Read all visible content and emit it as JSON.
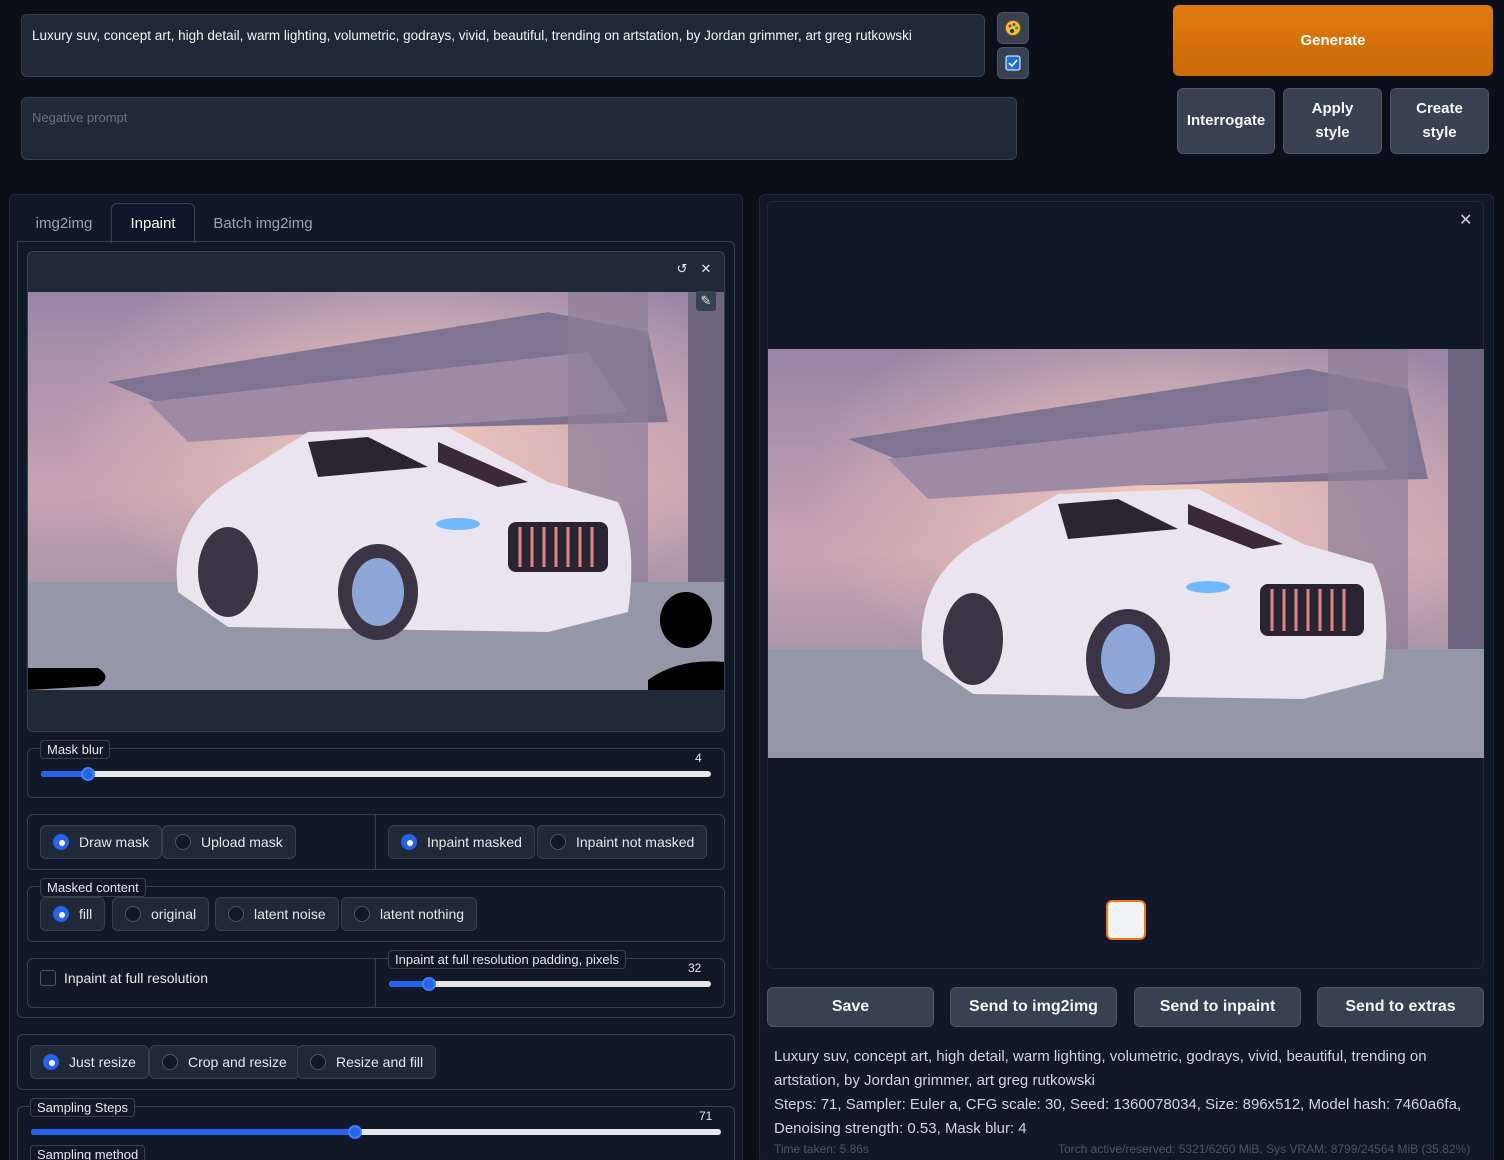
{
  "prompt": {
    "text": "Luxury suv, concept art, high detail, warm lighting, volumetric, godrays, vivid, beautiful, trending on artstation, by Jordan grimmer, art greg rutkowski",
    "negative_placeholder": "Negative prompt"
  },
  "actions": {
    "generate": "Generate",
    "interrogate": "Interrogate",
    "apply_style": "Apply style",
    "create_style": "Create style"
  },
  "tabs": [
    "img2img",
    "Inpaint",
    "Batch img2img"
  ],
  "mask_blur": {
    "label": "Mask blur",
    "value": "4",
    "fraction": 0.07
  },
  "mask_mode": {
    "draw": "Draw mask",
    "upload": "Upload mask",
    "selected": "Draw mask"
  },
  "inpaint_mode": {
    "masked": "Inpaint masked",
    "not_masked": "Inpaint not masked",
    "selected": "Inpaint masked"
  },
  "masked_content": {
    "label": "Masked content",
    "options": [
      "fill",
      "original",
      "latent noise",
      "latent nothing"
    ],
    "selected": "fill"
  },
  "full_res": {
    "checkbox_label": "Inpaint at full resolution",
    "padding_label": "Inpaint at full resolution padding, pixels",
    "padding_value": "32",
    "padding_fraction": 0.125
  },
  "resize_mode": {
    "options": [
      "Just resize",
      "Crop and resize",
      "Resize and fill"
    ],
    "selected": "Just resize"
  },
  "sampling_steps": {
    "label": "Sampling Steps",
    "value": "71",
    "fraction": 0.47
  },
  "sampling_method": {
    "label": "Sampling method"
  },
  "output_buttons": {
    "save": "Save",
    "send_img2img": "Send to img2img",
    "send_inpaint": "Send to inpaint",
    "send_extras": "Send to extras"
  },
  "output_info": {
    "prompt": "Luxury suv, concept art, high detail, warm lighting, volumetric, godrays, vivid, beautiful, trending on artstation, by Jordan grimmer, art greg rutkowski",
    "params": "Steps: 71, Sampler: Euler a, CFG scale: 30, Seed: 1360078034, Size: 896x512, Model hash: 7460a6fa, Denoising strength: 0.53, Mask blur: 4",
    "time": "Time taken: 5.86s",
    "vram": "Torch active/reserved: 5321/6260 MiB, Sys VRAM: 8799/24564 MiB (35.82%)"
  },
  "colors": {
    "accent": "#2563eb",
    "generate": "#d97706",
    "background": "#0b0f19"
  }
}
